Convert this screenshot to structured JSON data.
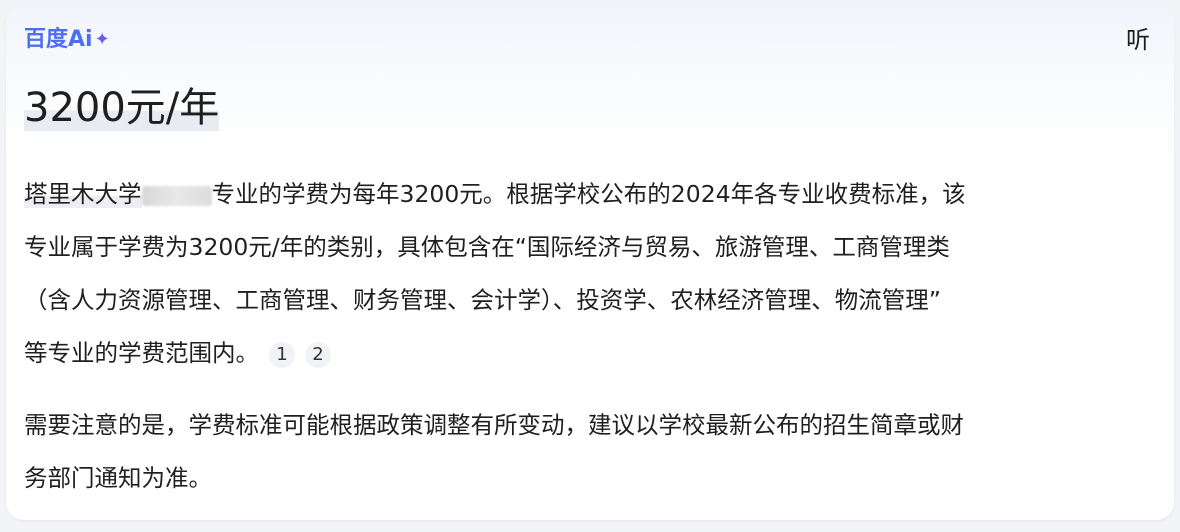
{
  "header": {
    "brand": "百度Ai",
    "brand_icon": "sparkle-icon",
    "listen_label": "听"
  },
  "answer": {
    "headline": "3200元/年",
    "paragraph1": {
      "line1_before": "塔里木大学",
      "line1_after": "专业的学费为每年3200元。根据学校公布的2024年各专业收费标准，该",
      "line2": "专业属于学费为3200元/年的类别，具体包含在“国际经济与贸易、旅游管理、工商管理类",
      "line3": "（含人力资源管理、工商管理、财务管理、会计学）、投资学、农林经济管理、物流管理”",
      "line4": "等专业的学费范围内。",
      "citations": [
        "1",
        "2"
      ]
    },
    "paragraph2": {
      "line1": "需要注意的是，学费标准可能根据政策调整有所变动，建议以学校最新公布的招生简章或财",
      "line2": "务部门通知为准。"
    }
  },
  "colors": {
    "brand": "#4e6ef2",
    "text": "#1f1f1f",
    "background": "#ffffff"
  }
}
